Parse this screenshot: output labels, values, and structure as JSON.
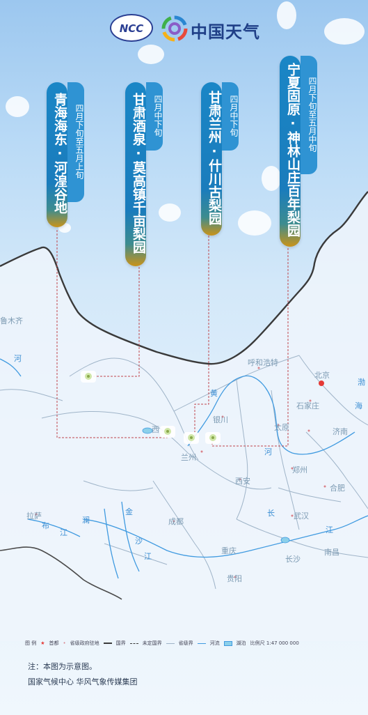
{
  "logos": {
    "ncc": "NCC",
    "cma_name": "中国天气"
  },
  "pins": [
    {
      "name": "青海海东·河湟谷地",
      "date": "四月下旬至五月上旬"
    },
    {
      "name": "甘肃酒泉·莫高镇千亩梨园",
      "date": "四月中下旬"
    },
    {
      "name": "甘肃兰州·什川古梨园",
      "date": "四月中下旬"
    },
    {
      "name": "宁夏固原·神林山庄百年梨园",
      "date": "四月下旬至五月中旬"
    }
  ],
  "cities": {
    "wulumuqi": "鲁木齐",
    "huhehaote": "呼和浩特",
    "beijing": "北京",
    "shijiazhuang": "石家庄",
    "taiyuan": "太原",
    "jinan": "济南",
    "zhengzhou": "郑州",
    "hefei": "合肥",
    "xian": "西安",
    "lanzhou": "兰州",
    "xining": "西",
    "yinchuan": "银川",
    "wuhan": "武汉",
    "chengdu": "成都",
    "chongqing": "重庆",
    "changsha": "长沙",
    "nanchang": "南昌",
    "lasa": "拉萨",
    "guiyang": "贵阳"
  },
  "rivers": {
    "he1": "河",
    "huang": "黄",
    "he2": "河",
    "chang": "长",
    "jiang1": "江",
    "jiang2": "江",
    "bu": "布",
    "lancang": "澜",
    "jin": "金",
    "sha": "沙",
    "jiang3": "江",
    "hai": "海",
    "bo": "渤"
  },
  "legend": {
    "title": "图 例",
    "capital": "首都",
    "provincial": "省级政府驻地",
    "border": "国界",
    "undefined_border": "未定国界",
    "province_border": "省级界",
    "river": "河流",
    "lake": "湖泊",
    "scale": "比例尺 1:47 000 000"
  },
  "footer": {
    "note": "注：本图为示意图。",
    "credit": "国家气候中心   华风气象传媒集团"
  }
}
